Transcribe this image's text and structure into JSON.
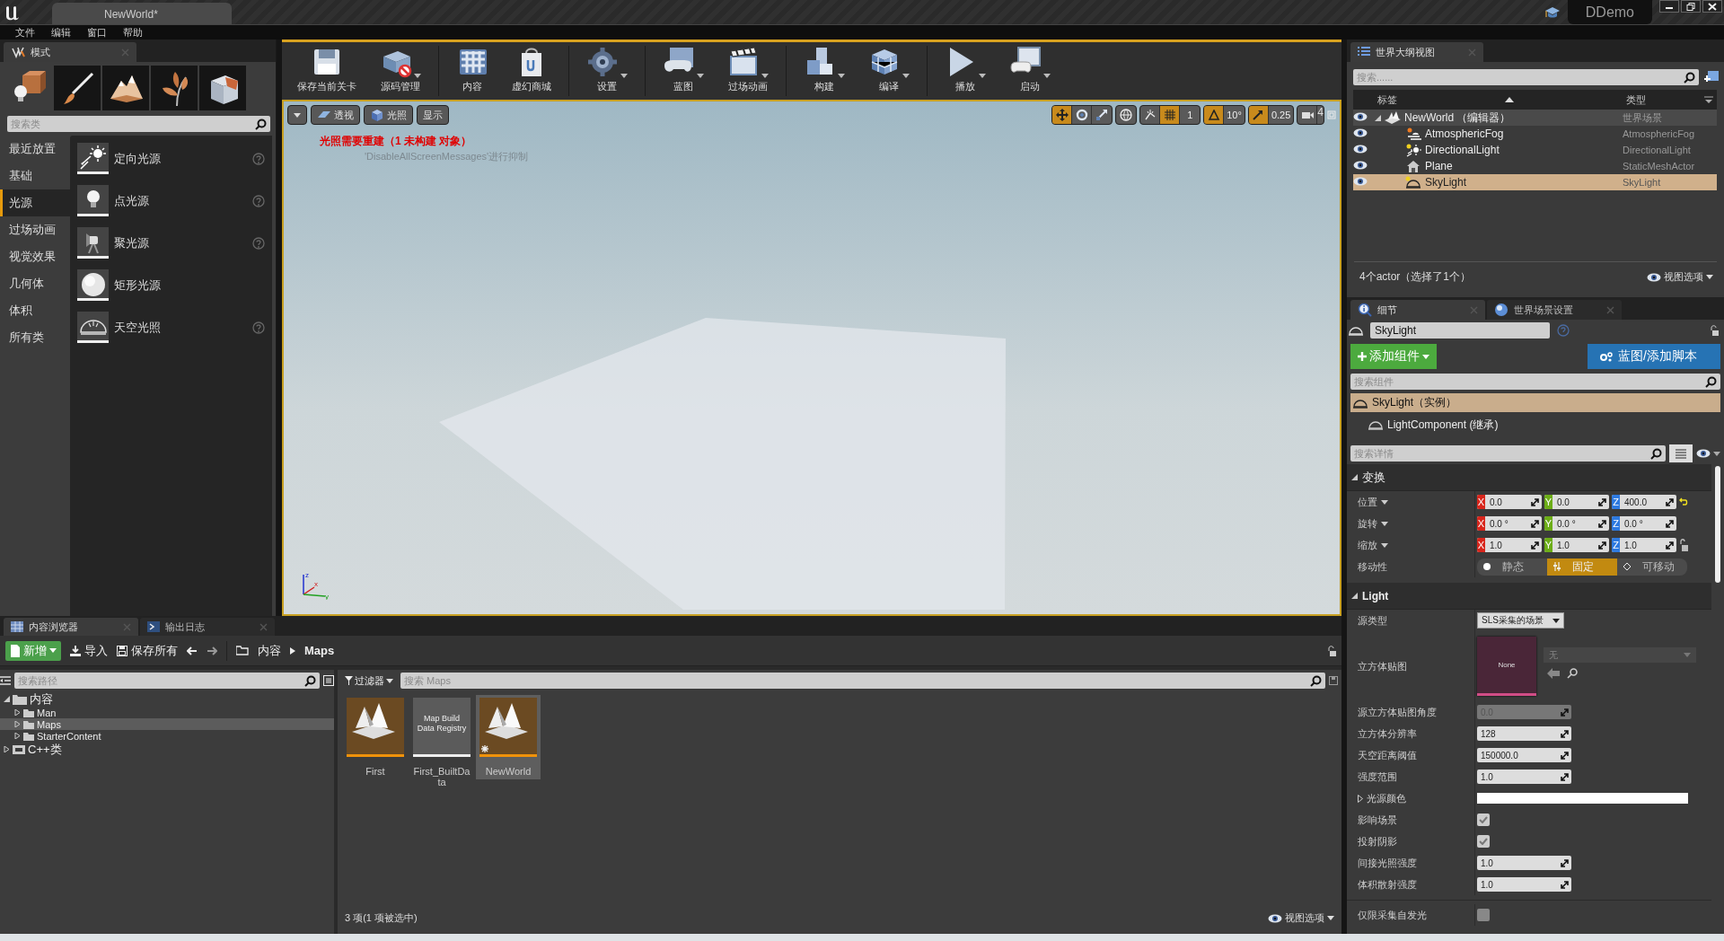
{
  "window": {
    "title": "NewWorld*",
    "project": "DDemo"
  },
  "menu": [
    "文件",
    "编辑",
    "窗口",
    "帮助"
  ],
  "modes_panel": {
    "tab": "模式",
    "modes": [
      {
        "kind": "place",
        "selected": true
      },
      {
        "kind": "paint",
        "selected": false
      },
      {
        "kind": "landscape",
        "selected": false
      },
      {
        "kind": "foliage",
        "selected": false
      },
      {
        "kind": "geometry",
        "selected": false
      }
    ],
    "search": {
      "placeholder": "搜索类"
    },
    "categories": [
      {
        "label": "最近放置",
        "selected": false
      },
      {
        "label": "基础",
        "selected": false
      },
      {
        "label": "光源",
        "selected": true
      },
      {
        "label": "过场动画",
        "selected": false
      },
      {
        "label": "视觉效果",
        "selected": false
      },
      {
        "label": "几何体",
        "selected": false
      },
      {
        "label": "体积",
        "selected": false
      },
      {
        "label": "所有类",
        "selected": false
      }
    ],
    "items": [
      {
        "label": "定向光源",
        "kind": "directional",
        "help": true
      },
      {
        "label": "点光源",
        "kind": "point",
        "help": true
      },
      {
        "label": "聚光源",
        "kind": "spot",
        "help": true
      },
      {
        "label": "矩形光源",
        "kind": "rect",
        "help": false
      },
      {
        "label": "天空光照",
        "kind": "sky",
        "help": true
      }
    ]
  },
  "toolbar": [
    {
      "label": "保存当前关卡",
      "kind": "save",
      "dropdown": false,
      "separator_before": false
    },
    {
      "label": "源码管理",
      "kind": "source",
      "dropdown": true,
      "separator_before": false
    },
    {
      "label": "内容",
      "kind": "content",
      "dropdown": false,
      "separator_before": true
    },
    {
      "label": "虚幻商城",
      "kind": "market",
      "dropdown": false,
      "separator_before": false
    },
    {
      "label": "设置",
      "kind": "settings",
      "dropdown": true,
      "separator_before": true
    },
    {
      "label": "蓝图",
      "kind": "blueprint",
      "dropdown": true,
      "separator_before": true
    },
    {
      "label": "过场动画",
      "kind": "cinematics",
      "dropdown": true,
      "separator_before": false
    },
    {
      "label": "构建",
      "kind": "build",
      "dropdown": true,
      "separator_before": true
    },
    {
      "label": "编译",
      "kind": "compile",
      "dropdown": true,
      "separator_before": false
    },
    {
      "label": "播放",
      "kind": "play",
      "dropdown": true,
      "separator_before": true
    },
    {
      "label": "启动",
      "kind": "launch",
      "dropdown": true,
      "separator_before": false
    }
  ],
  "viewport": {
    "view_buttons": [
      {
        "label": "透视",
        "kind": "perspective"
      },
      {
        "label": "光照",
        "kind": "lit"
      },
      {
        "label": "显示",
        "kind": "show"
      }
    ],
    "warning": "光照需要重建（1 未构建 对象）",
    "note": "'DisableAllScreenMessages'进行抑制",
    "transform_tools": [
      {
        "kind": "move",
        "selected": true
      },
      {
        "kind": "rotate",
        "selected": false
      },
      {
        "kind": "scale",
        "selected": false
      }
    ],
    "axis_labels": [
      "z",
      "x",
      "y"
    ],
    "grid_snap": "1",
    "rotation_snap": "10°",
    "scale_snap": "0.25",
    "camera_speed": "4"
  },
  "outliner": {
    "tab": "世界大纲视图",
    "search": {
      "placeholder": "搜索......"
    },
    "columns": [
      "标签",
      "类型"
    ],
    "rows": [
      {
        "label": "NewWorld （编辑器）",
        "type": "世界场景",
        "kind": "world",
        "expanded": true,
        "selected": false,
        "children": [
          {
            "label": "AtmosphericFog",
            "type": "AtmosphericFog",
            "kind": "fog",
            "selected": false
          },
          {
            "label": "DirectionalLight",
            "type": "DirectionalLight",
            "kind": "sun",
            "selected": false
          },
          {
            "label": "Plane",
            "type": "StaticMeshActor",
            "kind": "mesh",
            "selected": false
          },
          {
            "label": "SkyLight",
            "type": "SkyLight",
            "kind": "sky",
            "selected": true
          }
        ]
      }
    ],
    "summary": "4个actor（选择了1个）",
    "view_options": "视图选项"
  },
  "details": {
    "tabs": [
      {
        "label": "细节",
        "selected": true
      },
      {
        "label": "世界场景设置",
        "selected": false
      }
    ],
    "actor_name": "SkyLight",
    "add_component": "添加组件",
    "blueprint": "蓝图/添加脚本",
    "component_search": {
      "placeholder": "搜索组件"
    },
    "components": [
      {
        "label": "SkyLight（实例）",
        "selected": true,
        "children": [
          {
            "label": "LightComponent (继承)",
            "selected": false
          }
        ]
      }
    ],
    "details_search": {
      "placeholder": "搜索详情"
    },
    "sections": [
      {
        "title": "变换",
        "expanded": true,
        "rows": [
          {
            "kind": "vector",
            "label": "位置",
            "axes": [
              "X",
              "Y",
              "Z"
            ],
            "values": [
              "0.0",
              "0.0",
              "400.0"
            ],
            "reset": true,
            "lock": false
          },
          {
            "kind": "vector",
            "label": "旋转",
            "axes": [
              "X",
              "Y",
              "Z"
            ],
            "values": [
              "0.0 °",
              "0.0 °",
              "0.0 °"
            ],
            "reset": false,
            "lock": false
          },
          {
            "kind": "vector",
            "label": "缩放",
            "axes": [
              "X",
              "Y",
              "Z"
            ],
            "values": [
              "1.0",
              "1.0",
              "1.0"
            ],
            "reset": false,
            "lock": true
          },
          {
            "kind": "mobility",
            "label": "移动性",
            "options": [
              {
                "label": "静态",
                "selected": false
              },
              {
                "label": "固定",
                "selected": true
              },
              {
                "label": "可移动",
                "selected": false
              }
            ]
          }
        ]
      },
      {
        "title": "Light",
        "expanded": true,
        "rows": [
          {
            "kind": "dropdown",
            "label": "源类型",
            "value": "SLS采集的场景"
          },
          {
            "kind": "texture",
            "label": "立方体贴图",
            "thumb": "None",
            "value": "无"
          },
          {
            "kind": "number",
            "label": "源立方体贴图角度",
            "value": "0.0",
            "disabled": true
          },
          {
            "kind": "number",
            "label": "立方体分辨率",
            "value": "128",
            "disabled": false
          },
          {
            "kind": "number",
            "label": "天空距离阈值",
            "value": "150000.0",
            "disabled": false
          },
          {
            "kind": "number",
            "label": "强度范围",
            "value": "1.0",
            "disabled": false
          },
          {
            "kind": "color",
            "label": "光源颜色"
          },
          {
            "kind": "checkbox",
            "label": "影响场景",
            "checked": true
          },
          {
            "kind": "checkbox",
            "label": "投射阴影",
            "checked": true
          },
          {
            "kind": "number",
            "label": "间接光照强度",
            "value": "1.0",
            "disabled": false
          },
          {
            "kind": "number",
            "label": "体积散射强度",
            "value": "1.0",
            "disabled": false
          },
          {
            "kind": "checkbox",
            "label": "仅限采集自发光",
            "checked": false
          }
        ]
      }
    ]
  },
  "content_browser": {
    "tabs": [
      {
        "label": "内容浏览器",
        "selected": true
      },
      {
        "label": "输出日志",
        "selected": false
      }
    ],
    "new": "新增",
    "import": "导入",
    "save_all": "保存所有",
    "path": [
      "内容",
      "Maps"
    ],
    "path_search": {
      "placeholder": "搜索路径"
    },
    "tree": [
      {
        "label": "内容",
        "kind": "folder",
        "expanded": true,
        "selected": false,
        "children": [
          {
            "label": "Man",
            "kind": "folder",
            "expanded": false,
            "selected": false
          },
          {
            "label": "Maps",
            "kind": "folder",
            "expanded": false,
            "selected": true
          },
          {
            "label": "StarterContent",
            "kind": "folder",
            "expanded": false,
            "selected": false
          }
        ]
      },
      {
        "label": "C++类",
        "kind": "code",
        "expanded": false,
        "selected": false
      }
    ],
    "filter": "过滤器",
    "search": {
      "placeholder": "搜索 Maps"
    },
    "assets": [
      {
        "name": "First",
        "kind": "map",
        "selected": false,
        "modified": false
      },
      {
        "name": "First_BuiltData",
        "kind": "registry",
        "thumb_text": "Map Build Data Registry",
        "selected": false,
        "modified": false
      },
      {
        "name": "NewWorld",
        "kind": "map",
        "selected": true,
        "modified": true
      }
    ],
    "summary": "3 项(1 项被选中)",
    "view_options": "视图选项"
  }
}
